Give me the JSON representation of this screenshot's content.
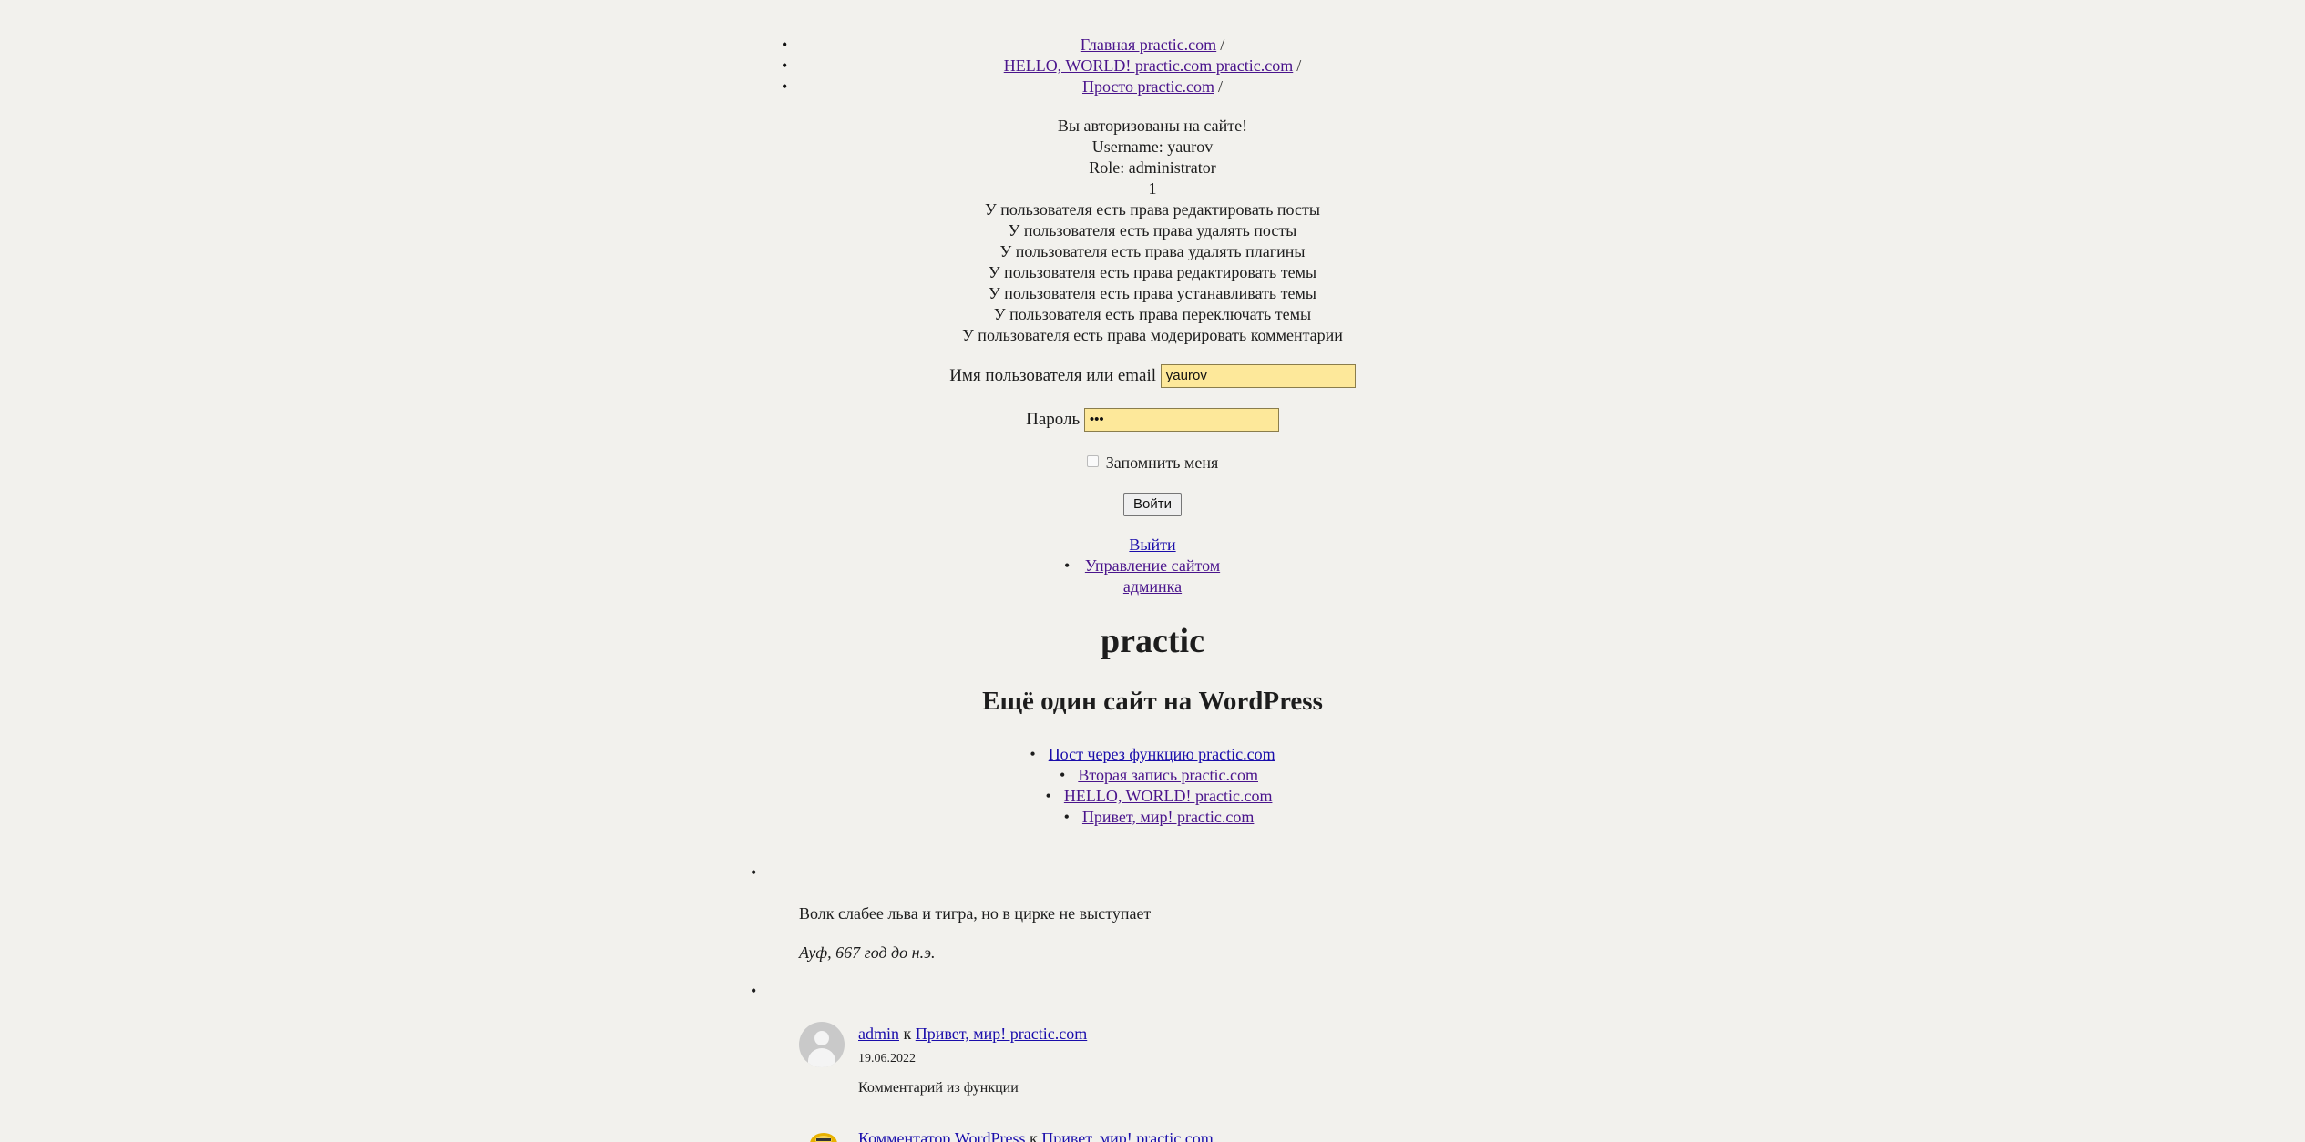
{
  "breadcrumbs": [
    {
      "label": "Главная practic.com",
      "sep": "/"
    },
    {
      "label": "HELLO, WORLD! practic.com practic.com",
      "sep": "/"
    },
    {
      "label": "Просто practic.com",
      "sep": "/"
    }
  ],
  "auth": {
    "status": "Вы авторизованы на сайте!",
    "username": "Username: yaurov",
    "role": "Role: administrator",
    "level": "1",
    "permissions": [
      "У пользователя есть права редактировать посты",
      "У пользователя есть права удалять посты",
      "У пользователя есть права удалять плагины",
      "У пользователя есть права редактировать темы",
      "У пользователя есть права устанавливать темы",
      "У пользователя есть права переключать темы",
      "У пользователя есть права модерировать комментарии"
    ]
  },
  "login": {
    "username_label": "Имя пользователя или email",
    "username_value": "yaurov",
    "password_label": "Пароль",
    "password_value": "•••",
    "remember_label": "Запомнить меня",
    "submit_label": "Войти"
  },
  "admin_links": {
    "logout": "Выйти",
    "manage": "Управление сайтом",
    "admin": "админка"
  },
  "site": {
    "title": "practic",
    "description": "Ещё один сайт на WordPress"
  },
  "posts": [
    "Пост через функцию practic.com",
    "Вторая запись practic.com",
    "HELLO, WORLD! practic.com",
    "Привет, мир! practic.com"
  ],
  "quote": {
    "text": "Волк слабее льва и тигра, но в цирке не выступает",
    "author": "Ауф, 667 год до н.э."
  },
  "comments": [
    {
      "author": "admin",
      "connector": "к",
      "post": "Привет, мир! practic.com",
      "date": "19.06.2022",
      "text": "Комментарий из функции"
    },
    {
      "author": "Комментатор WordPress",
      "connector": "к",
      "post": "Привет, мир! practic.com"
    }
  ],
  "colors": {
    "background": "#f2f1ed",
    "visited_link": "#4a148c",
    "link": "#1a0dab",
    "autofill": "#fde89a"
  }
}
